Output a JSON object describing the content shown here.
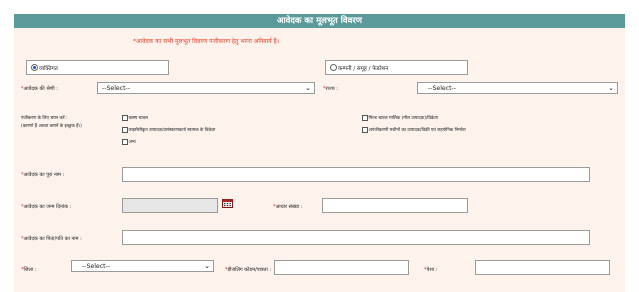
{
  "header": {
    "title": "आवेदक का मूलभूत विवरण"
  },
  "note": "*आवेदक का सभी मूलभूत विवरण पंजीकरण हेतु भरना अनिवार्य है।",
  "applicant_type": {
    "individual_label": "व्यक्तिगत",
    "company_label": "कम्पनी / समूह / फेडरेशन",
    "selected": "individual"
  },
  "category": {
    "label": "आवेदक की श्रेणी :",
    "value": "--Select--"
  },
  "state": {
    "label": "राज्य :",
    "value": "--Select--"
  },
  "registration": {
    "label_line1": "पंजीकरण के लिए चयन करें :",
    "label_line2": "(कारणों हैं अथवा करानें के इच्छुक हैं।)",
    "options": [
      "कास्य चावल",
      "मिल्ड चावल मालिक (मील उत्पादक)/विक्रेता",
      "लाइसेंसीकृत उत्पादक/प्रसंस्करणकर्ता स्वामक के विक्रेता",
      "अपंजीकरणी मशीनों का उत्पादक/विक्री एवं सहयोगिक निर्माता",
      "अन्य"
    ]
  },
  "full_name": {
    "label": "आवेदक का पूरा नाम :",
    "value": ""
  },
  "dob": {
    "label": "आवेदक का जन्म दिनांक :",
    "value": ""
  },
  "aadhaar": {
    "label": "आधार संख्या :",
    "value": ""
  },
  "father_name": {
    "label": "आवेदक का पिता/पति का नाम :",
    "value": ""
  },
  "district": {
    "label": "जिला :",
    "value": "--Select--"
  },
  "pincode": {
    "label": "डीजलिंग कोडम/पात्रता :",
    "value": ""
  },
  "block": {
    "label": "पेशा :",
    "value": ""
  },
  "icons": {
    "calendar": "calendar-icon",
    "dropdown": "chevron-down-icon"
  },
  "colors": {
    "header_bg": "#5b9a9a",
    "form_bg": "#fdf2ec",
    "required": "#e02020",
    "note": "#e8402a"
  }
}
